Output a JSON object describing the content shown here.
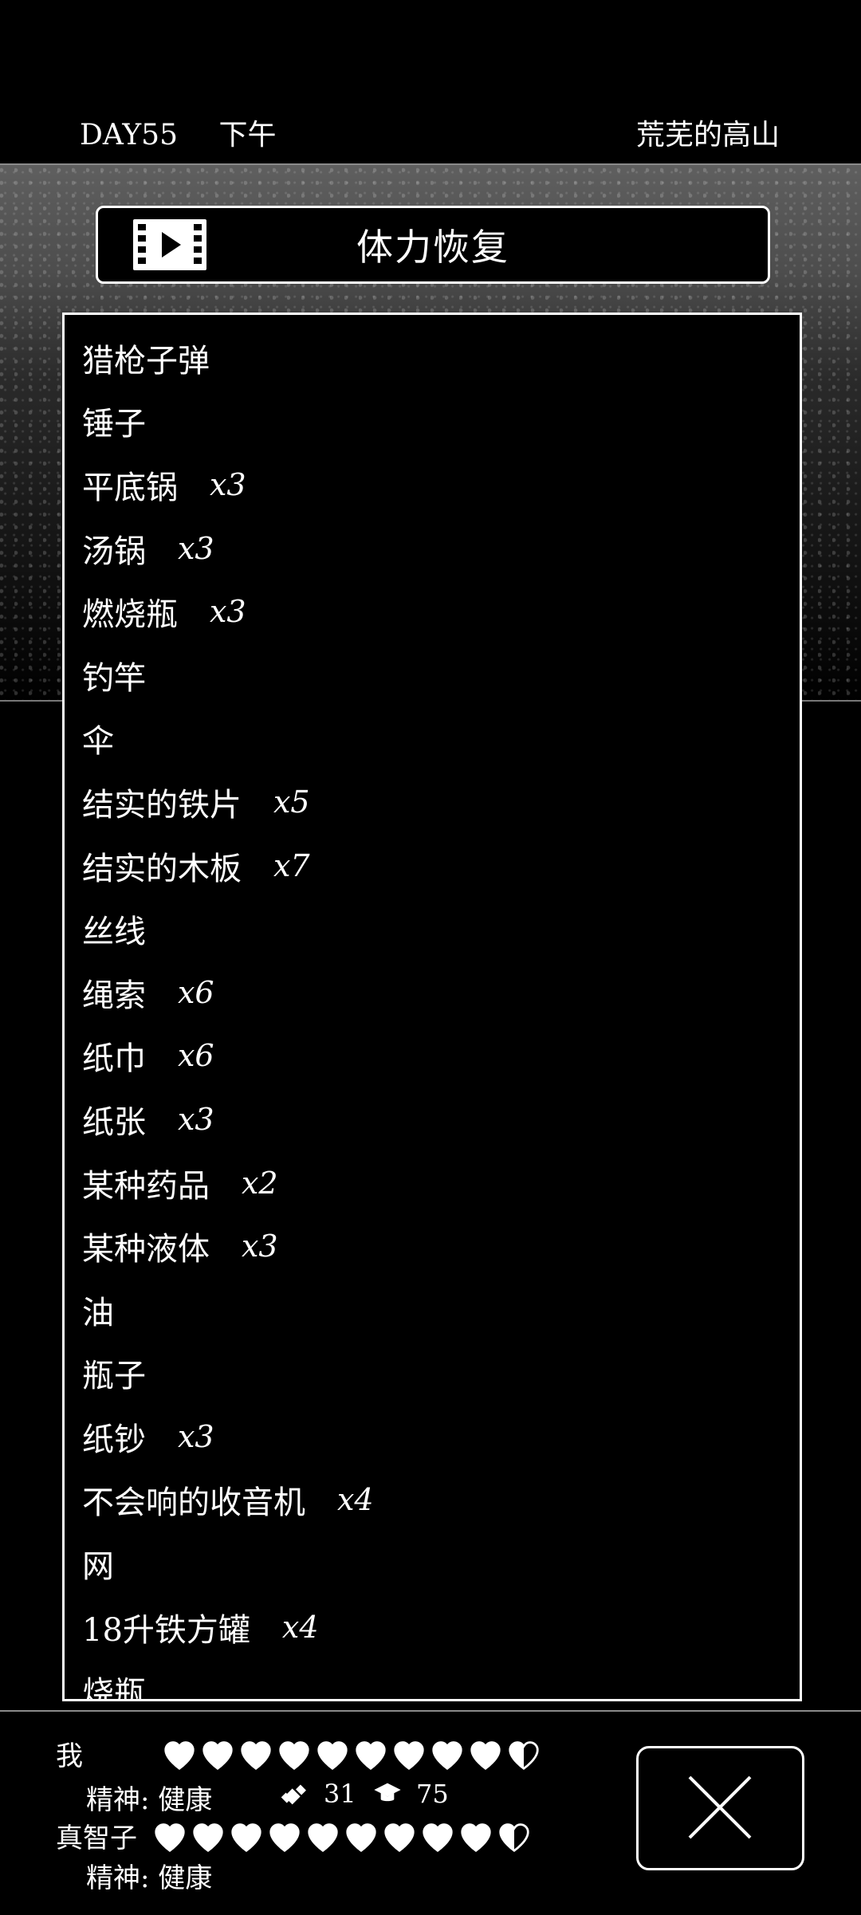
{
  "top": {
    "day": "DAY55",
    "time": "下午",
    "location": "荒芜的高山"
  },
  "action": {
    "title": "体力恢复",
    "icon": "video-play-icon"
  },
  "inventory": [
    {
      "name": "猎枪子弹",
      "qty": ""
    },
    {
      "name": "锤子",
      "qty": ""
    },
    {
      "name": "平底锅",
      "qty": "x3"
    },
    {
      "name": "汤锅",
      "qty": "x3"
    },
    {
      "name": "燃烧瓶",
      "qty": "x3"
    },
    {
      "name": "钓竿",
      "qty": ""
    },
    {
      "name": "伞",
      "qty": ""
    },
    {
      "name": "结实的铁片",
      "qty": "x5"
    },
    {
      "name": "结实的木板",
      "qty": "x7"
    },
    {
      "name": "丝线",
      "qty": ""
    },
    {
      "name": "绳索",
      "qty": "x6"
    },
    {
      "name": "纸巾",
      "qty": "x6"
    },
    {
      "name": "纸张",
      "qty": "x3"
    },
    {
      "name": "某种药品",
      "qty": "x2"
    },
    {
      "name": "某种液体",
      "qty": "x3"
    },
    {
      "name": "油",
      "qty": ""
    },
    {
      "name": "瓶子",
      "qty": ""
    },
    {
      "name": "纸钞",
      "qty": "x3"
    },
    {
      "name": "不会响的收音机",
      "qty": "x4"
    },
    {
      "name": "网",
      "qty": ""
    },
    {
      "name": "18升铁方罐",
      "qty": "x4"
    },
    {
      "name": "烧瓶",
      "qty": ""
    }
  ],
  "status": {
    "player": {
      "name": "我",
      "mind_label": "精神:",
      "mind_value": "健康",
      "hearts_full": 9,
      "hearts_half": 1,
      "strength": "31",
      "intellect": "75"
    },
    "companion": {
      "name": "真智子",
      "mind_label": "精神:",
      "mind_value": "健康",
      "hearts_full": 9,
      "hearts_half": 1
    }
  },
  "close_icon": "close-icon"
}
